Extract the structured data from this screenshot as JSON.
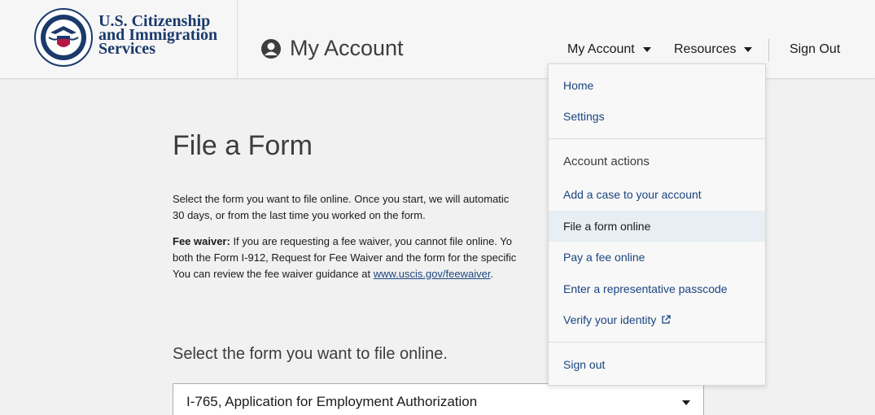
{
  "header": {
    "logo_lines": [
      "U.S. Citizenship",
      "and Immigration",
      "Services"
    ],
    "page_label": "My Account",
    "nav": {
      "my_account": "My Account",
      "resources": "Resources",
      "sign_out": "Sign Out"
    }
  },
  "main": {
    "title": "File a Form",
    "intro_line1": "Select the form you want to file online. Once you start, we will automatic",
    "intro_line2": "30 days, or from the last time you worked on the form.",
    "fee_label": "Fee waiver:",
    "fee_line1": " If you are requesting a fee waiver, you cannot file online. Yo",
    "fee_line2": "both the Form I-912, Request for Fee Waiver and the form for the specific",
    "fee_line3_prefix": "You can review the fee waiver guidance at  ",
    "fee_link": "www.uscis.gov/feewaiver",
    "fee_line3_suffix": ".",
    "select_heading": "Select the form you want to file online.",
    "select_value": "I-765, Application for Employment Authorization"
  },
  "dropdown": {
    "home": "Home",
    "settings": "Settings",
    "heading": "Account actions",
    "add_case": "Add a case to your account",
    "file_form": "File a form online",
    "pay_fee": "Pay a fee online",
    "passcode": "Enter a representative passcode",
    "verify": "Verify your identity",
    "sign_out": "Sign out"
  },
  "colors": {
    "link": "#1a4480",
    "active_bg": "#e7eef4",
    "brand": "#1a3a6b"
  },
  "icons": [
    "dhs-seal-icon",
    "user-circle-icon",
    "caret-down-icon",
    "external-link-icon"
  ]
}
